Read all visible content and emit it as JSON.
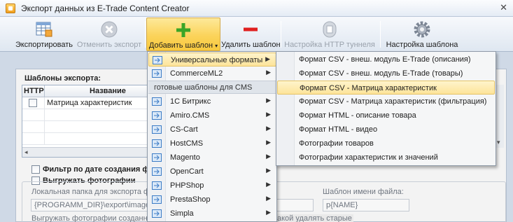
{
  "window": {
    "title": "Экспорт данных из E-Trade Content Creator"
  },
  "toolbar": {
    "export": "Экспортировать",
    "cancel_export": "Отменить экспорт",
    "add_template": "Добавить шаблон",
    "delete_template": "Удалить шаблон",
    "http_tunnel": "Настройка HTTP туннеля",
    "template_settings": "Настройка шаблона"
  },
  "templates_panel": {
    "title": "Шаблоны экспорта:",
    "columns": [
      "HTTP",
      "Название"
    ],
    "rows": [
      {
        "http": false,
        "name": "Матрица характеристик"
      }
    ]
  },
  "options": {
    "filter_by_photo_date": "Фильтр по дате создания ф",
    "export_photos": "Выгружать фотографии",
    "local_folder_label": "Локальная папка для экспорта фот",
    "local_folder_value": "{PROGRAMM_DIR}\\export\\images\\",
    "filename_template_label": "Шаблон имени файла:",
    "filename_template_value": "p{NAME}",
    "export_photos_created": "Выгружать фотографии созданные",
    "delete_old_tail": "акой удалять старые"
  },
  "menu_add_template": {
    "items_top": [
      {
        "label": "Универсальные форматы",
        "submenu": true,
        "highlighted": true
      },
      {
        "label": "CommerceML2",
        "submenu": true,
        "highlighted": false
      }
    ],
    "cms_header": "готовые шаблоны для CMS",
    "cms_items": [
      {
        "label": "1С Битрикс"
      },
      {
        "label": "Amiro.CMS"
      },
      {
        "label": "CS-Cart"
      },
      {
        "label": "HostCMS"
      },
      {
        "label": "Magento"
      },
      {
        "label": "OpenCart"
      },
      {
        "label": "PHPShop"
      },
      {
        "label": "PrestaShop"
      },
      {
        "label": "Simpla"
      }
    ]
  },
  "menu_universal_formats": {
    "items": [
      {
        "label": "Формат CSV - внеш. модуль E-Trade (описания)",
        "highlighted": false
      },
      {
        "label": "Формат CSV - внеш. модуль E-Trade (товары)",
        "highlighted": false
      },
      {
        "label": "Формат CSV - Матрица характеристик",
        "highlighted": true
      },
      {
        "label": "Формат CSV - Матрица характеристик (фильтрация)",
        "highlighted": false
      },
      {
        "label": "Формат HTML - описание товара",
        "highlighted": false
      },
      {
        "label": "Формат HTML - видео",
        "highlighted": false
      },
      {
        "label": "Фотографии товаров",
        "highlighted": false
      },
      {
        "label": "Фотографии характеристик и значений",
        "highlighted": false
      }
    ]
  },
  "colors": {
    "highlight": "#fde49a",
    "menu_bg": "#f5f6f7",
    "add_icon": "#3aa527",
    "delete_icon": "#e02020"
  }
}
